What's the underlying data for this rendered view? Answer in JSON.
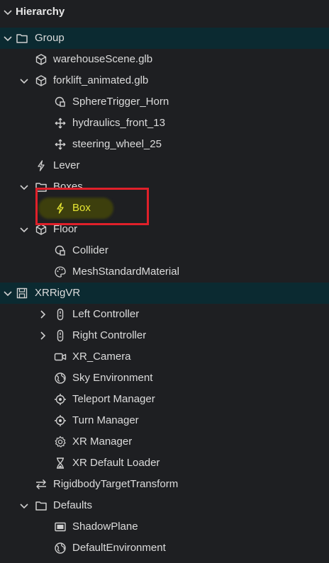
{
  "panel": {
    "title": "Hierarchy"
  },
  "tree": [
    {
      "label": "Group",
      "icon": "folder-icon",
      "expanded": true,
      "selected": true
    },
    {
      "label": "warehouseScene.glb",
      "icon": "cube-icon"
    },
    {
      "label": "forklift_animated.glb",
      "icon": "cube-icon",
      "expanded": true
    },
    {
      "label": "SphereTrigger_Horn",
      "icon": "sphere-collider-icon"
    },
    {
      "label": "hydraulics_front_13",
      "icon": "move-arrows-icon"
    },
    {
      "label": "steering_wheel_25",
      "icon": "move-arrows-icon"
    },
    {
      "label": "Lever",
      "icon": "lightning-icon"
    },
    {
      "label": "Boxes",
      "icon": "folder-icon",
      "expanded": true
    },
    {
      "label": "Box",
      "icon": "lightning-icon",
      "highlighted": true
    },
    {
      "label": "Floor",
      "icon": "cube-icon",
      "expanded": true
    },
    {
      "label": "Collider",
      "icon": "sphere-collider-icon"
    },
    {
      "label": "MeshStandardMaterial",
      "icon": "palette-icon"
    },
    {
      "label": "XRRigVR",
      "icon": "save-icon",
      "expanded": true,
      "selected": true
    },
    {
      "label": "Left Controller",
      "icon": "controller-icon",
      "collapsed": true
    },
    {
      "label": "Right Controller",
      "icon": "controller-icon",
      "collapsed": true
    },
    {
      "label": "XR_Camera",
      "icon": "camera-icon"
    },
    {
      "label": "Sky Environment",
      "icon": "globe-icon"
    },
    {
      "label": "Teleport Manager",
      "icon": "target-icon"
    },
    {
      "label": "Turn Manager",
      "icon": "target-icon"
    },
    {
      "label": "XR Manager",
      "icon": "gear-icon"
    },
    {
      "label": "XR Default Loader",
      "icon": "hourglass-icon"
    },
    {
      "label": "RigidbodyTargetTransform",
      "icon": "swap-arrows-icon"
    },
    {
      "label": "Defaults",
      "icon": "folder-icon",
      "expanded": true
    },
    {
      "label": "ShadowPlane",
      "icon": "plane-icon"
    },
    {
      "label": "DefaultEnvironment",
      "icon": "globe-icon"
    }
  ],
  "colors": {
    "background": "#1e1f22",
    "selected_row": "#0b2a31",
    "highlight_text": "#e6e633",
    "annotation_box": "#e0202a"
  }
}
